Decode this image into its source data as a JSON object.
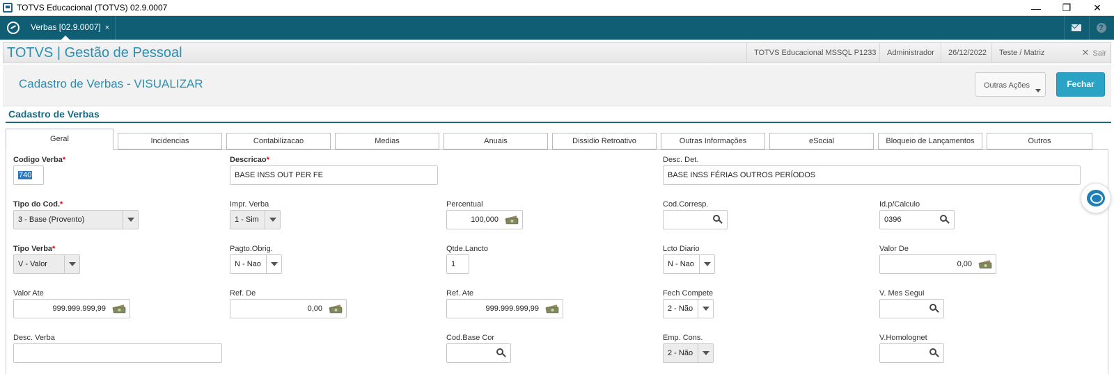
{
  "window": {
    "title": "TOTVS Educacional (TOTVS) 02.9.0007",
    "minimize": "—",
    "restore": "❐",
    "close": "✕"
  },
  "tabbar": {
    "tab_label": "Verbas [02.9.0007]",
    "tab_close": "×",
    "accent_color": "#105e74"
  },
  "app_header": {
    "brand": "TOTVS | Gestão de Pessoal",
    "environment": "TOTVS Educacional MSSQL P1233",
    "user": "Administrador",
    "date": "26/12/2022",
    "company": "Teste / Matriz",
    "logout": "Sair"
  },
  "page": {
    "title": "Cadastro de Verbas - VISUALIZAR",
    "other_actions": "Outras Ações",
    "close_button": "Fechar",
    "section_title": "Cadastro de Verbas"
  },
  "tabs": [
    {
      "label": "Geral",
      "active": true
    },
    {
      "label": "Incidencias"
    },
    {
      "label": "Contabilizacao"
    },
    {
      "label": "Medias"
    },
    {
      "label": "Anuais"
    },
    {
      "label": "Dissidio Retroativo"
    },
    {
      "label": "Outras Informações"
    },
    {
      "label": "eSocial"
    },
    {
      "label": "Bloqueio de Lançamentos"
    },
    {
      "label": "Outros"
    }
  ],
  "form": {
    "codigo_verba": {
      "label": "Codigo Verba",
      "value": "740"
    },
    "descricao": {
      "label": "Descricao",
      "value": "BASE INSS OUT PER FE"
    },
    "desc_det": {
      "label": "Desc. Det.",
      "value": "BASE INSS FÉRIAS OUTROS PERÍODOS"
    },
    "tipo_cod": {
      "label": "Tipo do Cod.",
      "value": "3 - Base (Provento)"
    },
    "impr_verba": {
      "label": "Impr. Verba",
      "value": "1 - Sim"
    },
    "percentual": {
      "label": "Percentual",
      "value": "100,000"
    },
    "cod_corresp": {
      "label": "Cod.Corresp.",
      "value": ""
    },
    "id_calculo": {
      "label": "Id.p/Calculo",
      "value": "0396"
    },
    "tipo_verba": {
      "label": "Tipo Verba",
      "value": "V - Valor"
    },
    "pagto_obrig": {
      "label": "Pagto.Obrig.",
      "value": "N - Nao"
    },
    "qtde_lancto": {
      "label": "Qtde.Lancto",
      "value": "1"
    },
    "lcto_diario": {
      "label": "Lcto Diario",
      "value": "N - Nao"
    },
    "valor_de": {
      "label": "Valor De",
      "value": "0,00"
    },
    "valor_ate": {
      "label": "Valor Ate",
      "value": "999.999.999,99"
    },
    "ref_de": {
      "label": "Ref. De",
      "value": "0,00"
    },
    "ref_ate": {
      "label": "Ref. Ate",
      "value": "999.999.999,99"
    },
    "fech_compete": {
      "label": "Fech Compete",
      "value": "2 - Não"
    },
    "v_mes_segui": {
      "label": "V. Mes Segui",
      "value": ""
    },
    "desc_verba": {
      "label": "Desc. Verba",
      "value": ""
    },
    "cod_base_cor": {
      "label": "Cod.Base Cor",
      "value": ""
    },
    "emp_cons": {
      "label": "Emp. Cons.",
      "value": "2 - Não"
    },
    "v_homolognet": {
      "label": "V.Homolognet",
      "value": ""
    }
  }
}
